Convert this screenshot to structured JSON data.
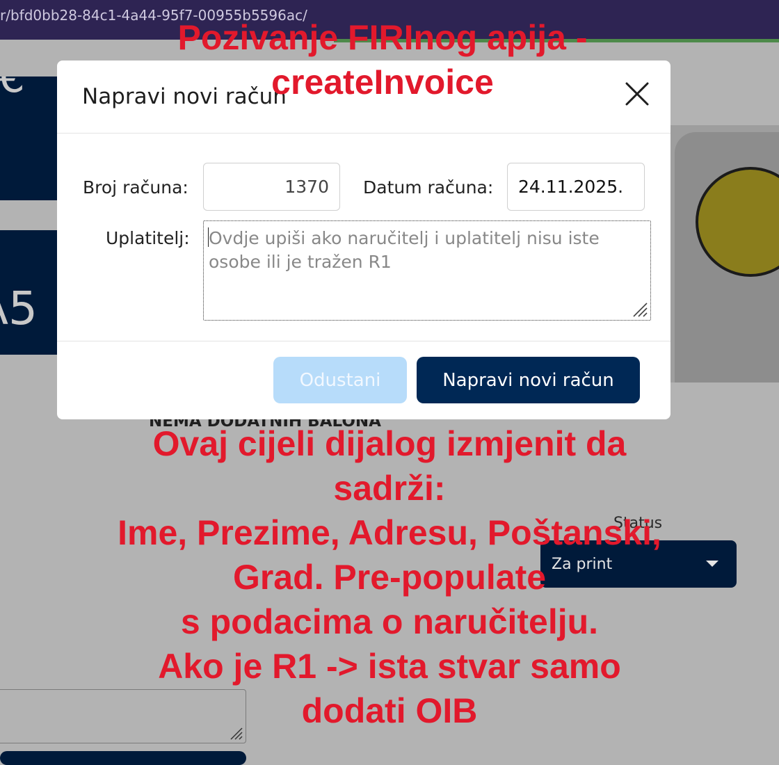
{
  "browser": {
    "url_fragment": "r/bfd0bb28-84c1-4a44-95f7-00955b5596ac/"
  },
  "background": {
    "card1_text": "€",
    "card2_text": "A5",
    "note": "NEMA DODATNIH BALONA",
    "status_label": "Status",
    "status_value": "Za print"
  },
  "modal": {
    "title": "Napravi novi račun",
    "invoice_number_label": "Broj računa:",
    "invoice_number_value": "1370",
    "invoice_date_label": "Datum računa:",
    "invoice_date_value": "24.11.2025.",
    "payer_label": "Uplatitelj:",
    "payer_placeholder": "Ovdje upiši ako naručitelj i uplatitelj nisu iste osobe ili je tražen R1",
    "cancel_label": "Odustani",
    "submit_label": "Napravi novi račun"
  },
  "annotations": {
    "top": [
      "Pozivanje FIRInog apija -",
      "createInvoice"
    ],
    "bottom": [
      "Ovaj cijeli dijalog izmjenit da",
      "sadrži:",
      "Ime, Prezime, Adresu, Poštanski,",
      "Grad. Pre-populate",
      "s podacima o naručitelju.",
      "Ako je R1 -> ista stvar samo",
      "dodati OIB"
    ]
  },
  "colors": {
    "overlay": "#b3b3b3",
    "navy": "#002855",
    "annotation_red": "#e2192c",
    "cancel_disabled": "#b7dcfa"
  }
}
